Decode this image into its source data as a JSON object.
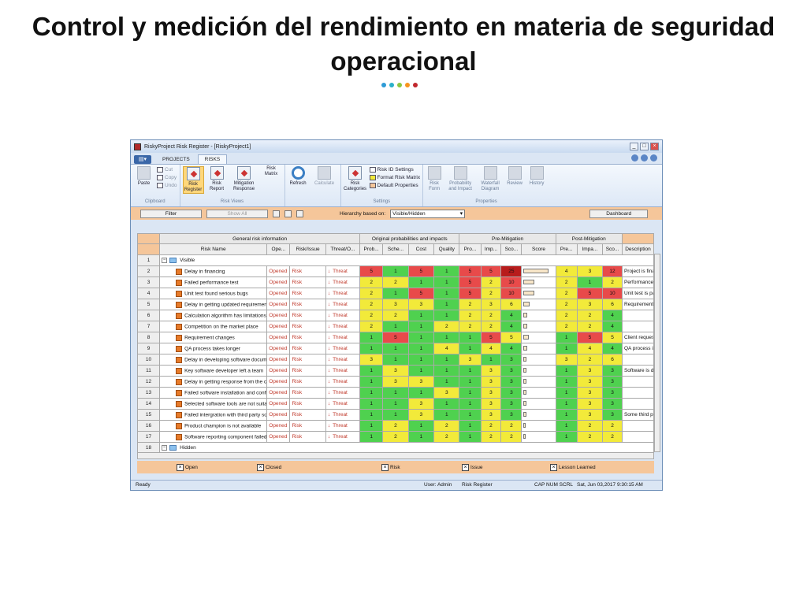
{
  "slide": {
    "title": "Control y medición del rendimiento en materia de seguridad operacional",
    "dot_colors": [
      "#2e9bd6",
      "#2ab0c9",
      "#8cc63f",
      "#f7941d",
      "#c1272d"
    ]
  },
  "window": {
    "title": "RiskyProject Risk Register - [RiskyProject1]",
    "minimize": "_",
    "maximize": "□",
    "close": "×"
  },
  "tabs": [
    "PROJECTS",
    "RISKS"
  ],
  "ribbon": {
    "clipboard": {
      "paste": "Paste",
      "cut": "Cut",
      "copy": "Copy",
      "undo": "Undo",
      "label": "Clipboard"
    },
    "risk_views": {
      "risk_register": "Risk Register",
      "risk_report": "Risk Report",
      "mitigation_response": "Mitigation Response",
      "risk_matrix": "Risk Matrix",
      "label": "Risk Views"
    },
    "refresh": "Refresh",
    "calculate": "Calculate",
    "settings": {
      "risk_categories": "Risk Categories",
      "risk_id_settings": "Risk ID Settings",
      "format_risk_matrix": "Format Risk Matrix",
      "default_properties": "Default Properties",
      "label": "Settings"
    },
    "properties": {
      "risk_form": "Risk Form",
      "probability_impact": "Probability and Impact",
      "waterfall": "Waterfall Diagram",
      "review": "Review",
      "history": "History",
      "label": "Properties"
    }
  },
  "filter_bar": {
    "filter": "Filter",
    "show_all": "Show All",
    "hierarchy_label": "Hierarchy based on:",
    "hierarchy_value": "Visible/Hidden",
    "dashboard": "Dashboard"
  },
  "table": {
    "group_headers": {
      "general": "General risk information",
      "original": "Original probabilities and impacts",
      "pre": "Pre-Mitigation",
      "post": "Post-Mitigation"
    },
    "columns": [
      "Risk Name",
      "Ope...",
      "Risk/Issue",
      "Threat/O...",
      "Prob...",
      "Sche...",
      "Cost",
      "Quality",
      "Pro...",
      "Imp...",
      "Sco...",
      "Score",
      "Pre...",
      "Impa...",
      "Sco...",
      "Description"
    ],
    "group_visible": "Visible",
    "group_hidden": "Hidden",
    "rows": [
      {
        "n": "2",
        "name": "Delay in financing",
        "status": "Opened",
        "type": "Risk",
        "threat": "Threat",
        "orig": [
          "5",
          "1",
          "5",
          "1"
        ],
        "pre": [
          "5",
          "5",
          "25"
        ],
        "score": 0.95,
        "post": [
          "4",
          "3",
          "12"
        ],
        "desc": "Project is fina"
      },
      {
        "n": "3",
        "name": "Failed performance test",
        "status": "Opened",
        "type": "Risk",
        "threat": "Threat",
        "orig": [
          "2",
          "2",
          "1",
          "1"
        ],
        "pre": [
          "5",
          "2",
          "10"
        ],
        "score": 0.4,
        "post": [
          "2",
          "1",
          "2"
        ],
        "desc": "Performance t"
      },
      {
        "n": "4",
        "name": "Unit test found serious bugs",
        "status": "Opened",
        "type": "Risk",
        "threat": "Threat",
        "orig": [
          "2",
          "1",
          "5",
          "1"
        ],
        "pre": [
          "5",
          "2",
          "10"
        ],
        "score": 0.4,
        "post": [
          "2",
          "5",
          "10"
        ],
        "desc": "Unit test is pa"
      },
      {
        "n": "5",
        "name": "Delay in getting updated requirements",
        "status": "Opened",
        "type": "Risk",
        "threat": "Threat",
        "orig": [
          "2",
          "3",
          "3",
          "1"
        ],
        "pre": [
          "2",
          "3",
          "6"
        ],
        "score": 0.24,
        "post": [
          "2",
          "3",
          "6"
        ],
        "desc": "Requirements"
      },
      {
        "n": "6",
        "name": "Calculation algorithm has limitations",
        "status": "Opened",
        "type": "Risk",
        "threat": "Threat",
        "orig": [
          "2",
          "2",
          "1",
          "1"
        ],
        "pre": [
          "2",
          "2",
          "4"
        ],
        "score": 0.16,
        "post": [
          "2",
          "2",
          "4"
        ],
        "desc": ""
      },
      {
        "n": "7",
        "name": "Competition on the market place",
        "status": "Opened",
        "type": "Risk",
        "threat": "Threat",
        "orig": [
          "2",
          "1",
          "1",
          "2"
        ],
        "pre": [
          "2",
          "2",
          "4"
        ],
        "score": 0.16,
        "post": [
          "2",
          "2",
          "4"
        ],
        "desc": ""
      },
      {
        "n": "8",
        "name": "Requirement changes",
        "status": "Opened",
        "type": "Risk",
        "threat": "Threat",
        "orig": [
          "1",
          "5",
          "1",
          "1"
        ],
        "pre": [
          "1",
          "5",
          "5"
        ],
        "score": 0.2,
        "post": [
          "1",
          "5",
          "5"
        ],
        "desc": "Client request"
      },
      {
        "n": "9",
        "name": "QA process takes longer",
        "status": "Opened",
        "type": "Risk",
        "threat": "Threat",
        "orig": [
          "1",
          "1",
          "1",
          "4"
        ],
        "pre": [
          "1",
          "4",
          "4"
        ],
        "score": 0.16,
        "post": [
          "1",
          "4",
          "4"
        ],
        "desc": "QA process ir"
      },
      {
        "n": "10",
        "name": "Delay in developing software docume",
        "status": "Opened",
        "type": "Risk",
        "threat": "Threat",
        "orig": [
          "3",
          "1",
          "1",
          "1"
        ],
        "pre": [
          "3",
          "1",
          "3"
        ],
        "score": 0.12,
        "post": [
          "3",
          "2",
          "6"
        ],
        "desc": ""
      },
      {
        "n": "11",
        "name": "Key software developer left a team",
        "status": "Opened",
        "type": "Risk",
        "threat": "Threat",
        "orig": [
          "1",
          "3",
          "1",
          "1"
        ],
        "pre": [
          "1",
          "3",
          "3"
        ],
        "score": 0.12,
        "post": [
          "1",
          "3",
          "3"
        ],
        "desc": "Software is d"
      },
      {
        "n": "12",
        "name": "Delay in getting response from the cli",
        "status": "Opened",
        "type": "Risk",
        "threat": "Threat",
        "orig": [
          "1",
          "3",
          "3",
          "1"
        ],
        "pre": [
          "1",
          "3",
          "3"
        ],
        "score": 0.12,
        "post": [
          "1",
          "3",
          "3"
        ],
        "desc": ""
      },
      {
        "n": "13",
        "name": "Failed software installation and config",
        "status": "Opened",
        "type": "Risk",
        "threat": "Threat",
        "orig": [
          "1",
          "1",
          "1",
          "3"
        ],
        "pre": [
          "1",
          "3",
          "3"
        ],
        "score": 0.12,
        "post": [
          "1",
          "3",
          "3"
        ],
        "desc": ""
      },
      {
        "n": "14",
        "name": "Selected software tools are not suita",
        "status": "Opened",
        "type": "Risk",
        "threat": "Threat",
        "orig": [
          "1",
          "1",
          "3",
          "1"
        ],
        "pre": [
          "1",
          "3",
          "3"
        ],
        "score": 0.12,
        "post": [
          "1",
          "3",
          "3"
        ],
        "desc": ""
      },
      {
        "n": "15",
        "name": "Failed intergration with third party sof",
        "status": "Opened",
        "type": "Risk",
        "threat": "Threat",
        "orig": [
          "1",
          "1",
          "3",
          "1"
        ],
        "pre": [
          "1",
          "3",
          "3"
        ],
        "score": 0.12,
        "post": [
          "1",
          "3",
          "3"
        ],
        "desc": "Some third pa"
      },
      {
        "n": "16",
        "name": "Product champion is not available",
        "status": "Opened",
        "type": "Risk",
        "threat": "Threat",
        "orig": [
          "1",
          "2",
          "1",
          "2"
        ],
        "pre": [
          "1",
          "2",
          "2"
        ],
        "score": 0.08,
        "post": [
          "1",
          "2",
          "2"
        ],
        "desc": ""
      },
      {
        "n": "17",
        "name": "Software reporting component failed",
        "status": "Opened",
        "type": "Risk",
        "threat": "Threat",
        "orig": [
          "1",
          "2",
          "1",
          "2"
        ],
        "pre": [
          "1",
          "2",
          "2"
        ],
        "score": 0.08,
        "post": [
          "1",
          "2",
          "2"
        ],
        "desc": ""
      }
    ]
  },
  "legend": [
    "Open",
    "Closed",
    "Risk",
    "Issue",
    "Lesson Learned"
  ],
  "status": {
    "ready": "Ready",
    "user": "User: Admin",
    "view": "Risk Register",
    "keys": "CAP  NUM  SCRL",
    "datetime": "Sat, Jun 03,2017   9:30:15 AM"
  }
}
